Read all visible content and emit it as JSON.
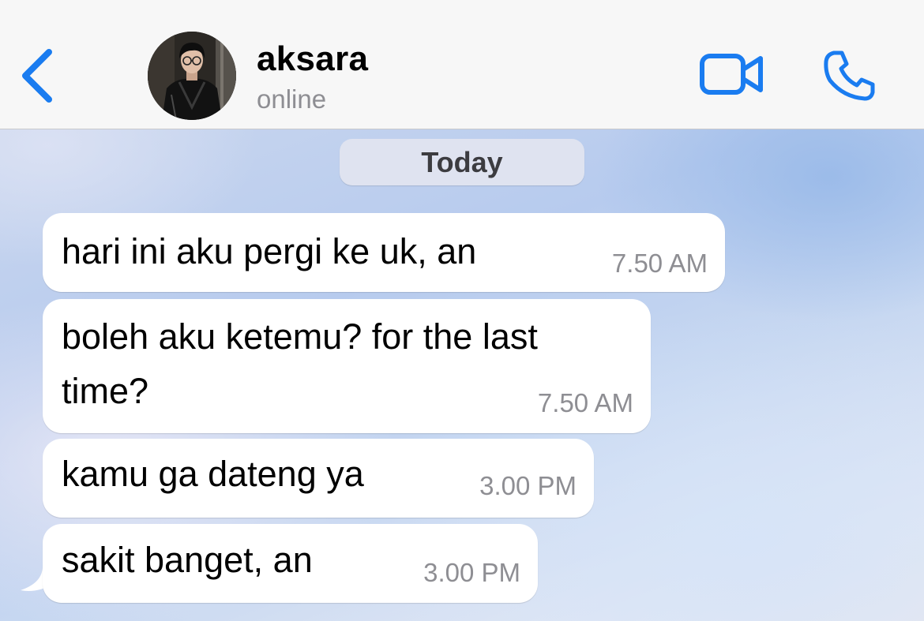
{
  "header": {
    "back_icon": "chevron-left-icon",
    "contact_name": "aksara",
    "contact_status": "online",
    "video_icon": "video-camera-icon",
    "call_icon": "phone-icon"
  },
  "chat": {
    "date_separator": "Today",
    "messages": [
      {
        "text": "hari ini aku pergi ke uk, an",
        "time": "7.50 AM",
        "direction": "incoming"
      },
      {
        "text_lines": [
          "boleh aku ketemu? for the last",
          "time?"
        ],
        "time": "7.50 AM",
        "direction": "incoming"
      },
      {
        "text": "kamu ga dateng ya",
        "time": "3.00 PM",
        "direction": "incoming"
      },
      {
        "text": "sakit banget, an",
        "time": "3.00 PM",
        "direction": "incoming"
      }
    ]
  },
  "colors": {
    "accent": "#1a7cf0",
    "bubble_incoming": "#ffffff",
    "header_bg": "#f7f7f7",
    "secondary_text": "#8e8e93"
  }
}
